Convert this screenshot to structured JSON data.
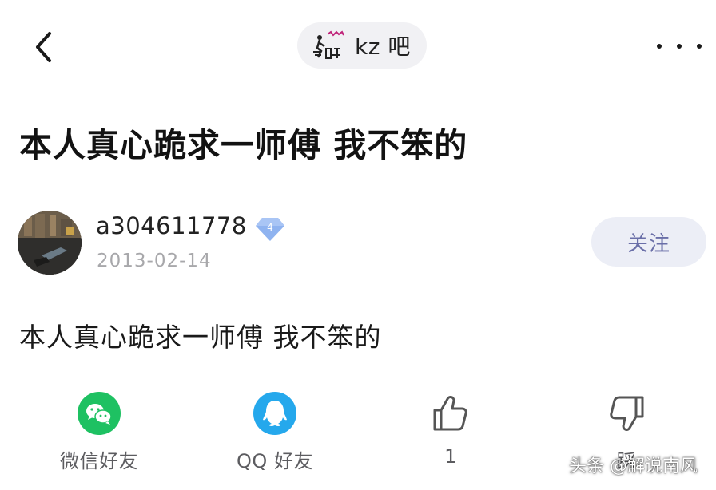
{
  "header": {
    "forum_name": "kz 吧",
    "back_icon": "chevron-left-icon",
    "more_icon": "more-dots-icon"
  },
  "post": {
    "title": "本人真心跪求一师傅 我不笨的",
    "author": {
      "username": "a304611778",
      "level": "4",
      "date": "2013-02-14"
    },
    "follow_label": "关注",
    "body": "本人真心跪求一师傅 我不笨的"
  },
  "actions": {
    "wechat_label": "微信好友",
    "qq_label": "QQ 好友",
    "like_count": "1",
    "dislike_label": "踩"
  },
  "watermark": "头条 @解说南风",
  "colors": {
    "wechat_green": "#1ec162",
    "qq_blue": "#25a8ec",
    "follow_text": "#6a6fa8",
    "follow_bg": "#eceef6",
    "badge_blue": "#8fb3f0"
  }
}
